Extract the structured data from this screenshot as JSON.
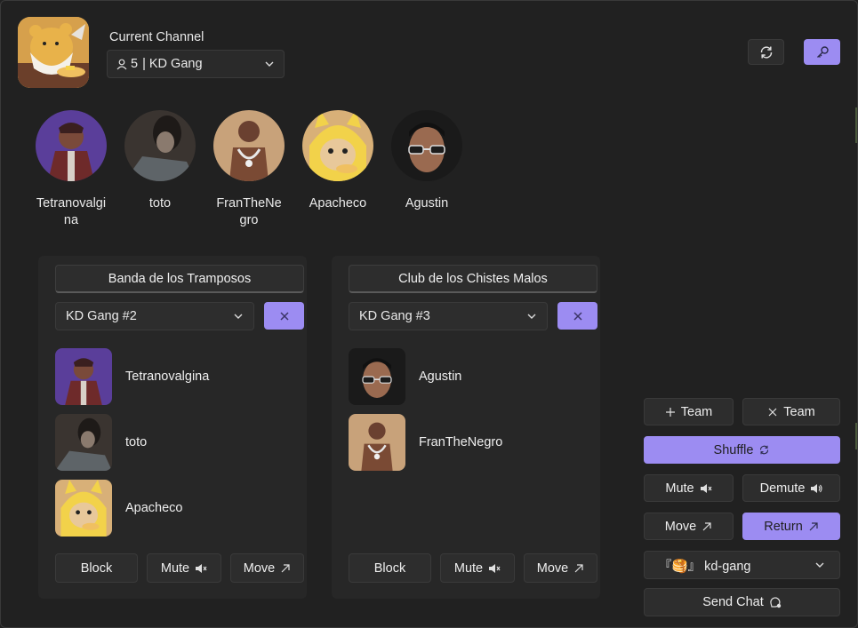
{
  "colors": {
    "accent": "#9c8cf2",
    "background": "#212121",
    "panel": "#272727",
    "control": "#2d2d2d"
  },
  "header": {
    "server_icon": "bear-mascot-icon",
    "channel_label": "Current Channel",
    "channel_select": {
      "count": "5",
      "value": "| KD Gang",
      "icon": "user-icon"
    },
    "refresh_icon": "refresh-icon",
    "key_icon": "key-icon"
  },
  "members": [
    {
      "name": "Tetranovalgina",
      "avatar": "hooded-person-avatar"
    },
    {
      "name": "toto",
      "avatar": "dark-photo-avatar"
    },
    {
      "name": "FranTheNegro",
      "avatar": "chain-necklace-avatar"
    },
    {
      "name": "Apacheco",
      "avatar": "pikachu-cat-avatar"
    },
    {
      "name": "Agustin",
      "avatar": "sunglasses-avatar"
    }
  ],
  "teams": [
    {
      "title": "Banda de los Tramposos",
      "channel": "KD Gang #2",
      "players": [
        "Tetranovalgina",
        "toto",
        "Apacheco"
      ],
      "actions": {
        "block": "Block",
        "mute": "Mute",
        "move": "Move"
      }
    },
    {
      "title": "Club de los Chistes Malos",
      "channel": "KD Gang #3",
      "players": [
        "Agustin",
        "FranTheNegro"
      ],
      "actions": {
        "block": "Block",
        "mute": "Mute",
        "move": "Move"
      }
    }
  ],
  "controls": {
    "add_team": "Team",
    "remove_team": "Team",
    "shuffle": "Shuffle",
    "mute": "Mute",
    "demute": "Demute",
    "move": "Move",
    "return": "Return",
    "text_channel": "『🥞』 kd-gang",
    "send_chat": "Send Chat"
  }
}
